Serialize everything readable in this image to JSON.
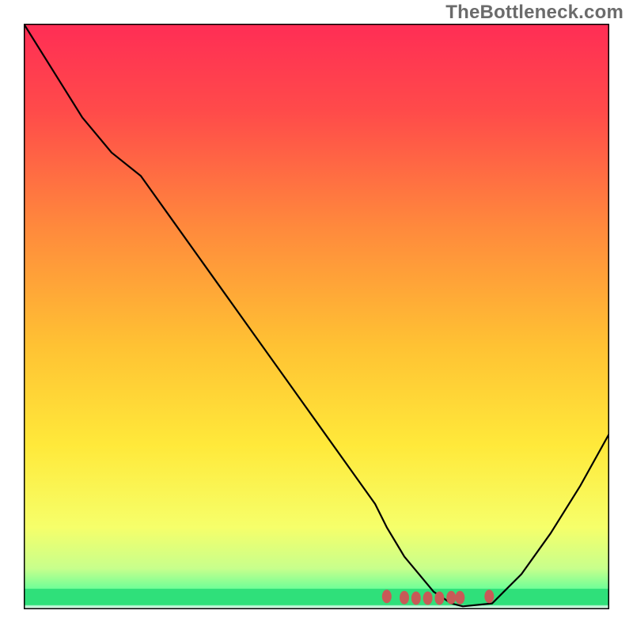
{
  "watermark": "TheBottleneck.com",
  "chart_data": {
    "type": "line",
    "title": "",
    "xlabel": "",
    "ylabel": "",
    "xlim": [
      0,
      100
    ],
    "ylim": [
      0,
      100
    ],
    "grid": false,
    "series": [
      {
        "name": "curve",
        "x": [
          0,
          5,
          10,
          15,
          20,
          25,
          30,
          35,
          40,
          45,
          50,
          55,
          60,
          62,
          65,
          70,
          73,
          75,
          80,
          85,
          90,
          95,
          100
        ],
        "y": [
          100,
          92,
          84,
          78,
          74,
          67,
          60,
          53,
          46,
          39,
          32,
          25,
          18,
          14,
          9,
          3,
          1,
          0.5,
          1,
          6,
          13,
          21,
          30
        ],
        "color": "#000000",
        "width": 2.2
      }
    ],
    "markers": {
      "points": [
        {
          "x": 62,
          "y": 2.2
        },
        {
          "x": 65,
          "y": 2.0
        },
        {
          "x": 67,
          "y": 1.9
        },
        {
          "x": 69,
          "y": 1.9
        },
        {
          "x": 71,
          "y": 1.9
        },
        {
          "x": 73,
          "y": 2.0
        },
        {
          "x": 74.5,
          "y": 2.0
        },
        {
          "x": 79.5,
          "y": 2.2
        }
      ],
      "color": "#c85a57",
      "size": 10
    },
    "gradient": {
      "stops": [
        {
          "offset": 0.0,
          "color": "#ff2d55"
        },
        {
          "offset": 0.15,
          "color": "#ff4b4a"
        },
        {
          "offset": 0.35,
          "color": "#ff8a3c"
        },
        {
          "offset": 0.55,
          "color": "#ffc233"
        },
        {
          "offset": 0.72,
          "color": "#ffe93a"
        },
        {
          "offset": 0.86,
          "color": "#f6ff6a"
        },
        {
          "offset": 0.93,
          "color": "#c8ff8c"
        },
        {
          "offset": 0.972,
          "color": "#5dff9a"
        },
        {
          "offset": 0.985,
          "color": "#2fe07a"
        },
        {
          "offset": 1.0,
          "color": "#ffffff"
        }
      ],
      "bottom_green_band": {
        "from": 0.965,
        "to": 0.993,
        "color": "#2fe07a"
      }
    }
  }
}
